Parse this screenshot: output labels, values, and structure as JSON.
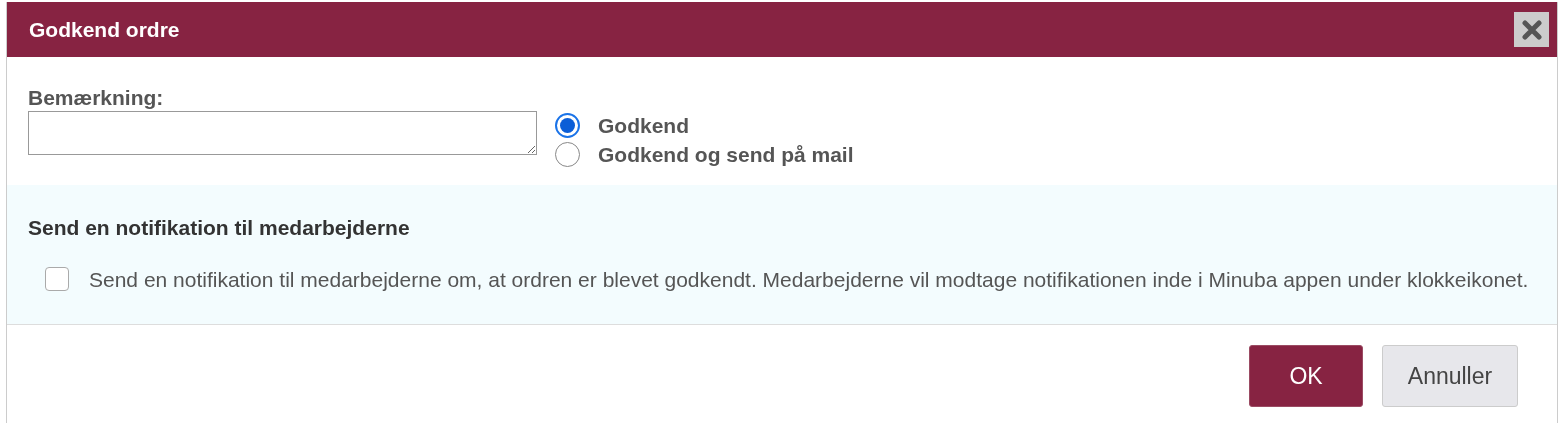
{
  "window": {
    "title": "Godkend ordre"
  },
  "remark": {
    "label": "Bemærkning:"
  },
  "options": [
    {
      "label": "Godkend",
      "selected": true
    },
    {
      "label": "Godkend og send på mail",
      "selected": false
    }
  ],
  "notification": {
    "heading": "Send en notifikation til medarbejderne",
    "checked": false,
    "text": "Send en notifikation til medarbejderne om, at ordren er blevet godkendt. Medarbejderne vil modtage notifikationen inde i Minuba appen under klokkeikonet."
  },
  "buttons": [
    {
      "label": "OK",
      "kind": "primary"
    },
    {
      "label": "Annuller",
      "kind": "secondary"
    }
  ]
}
